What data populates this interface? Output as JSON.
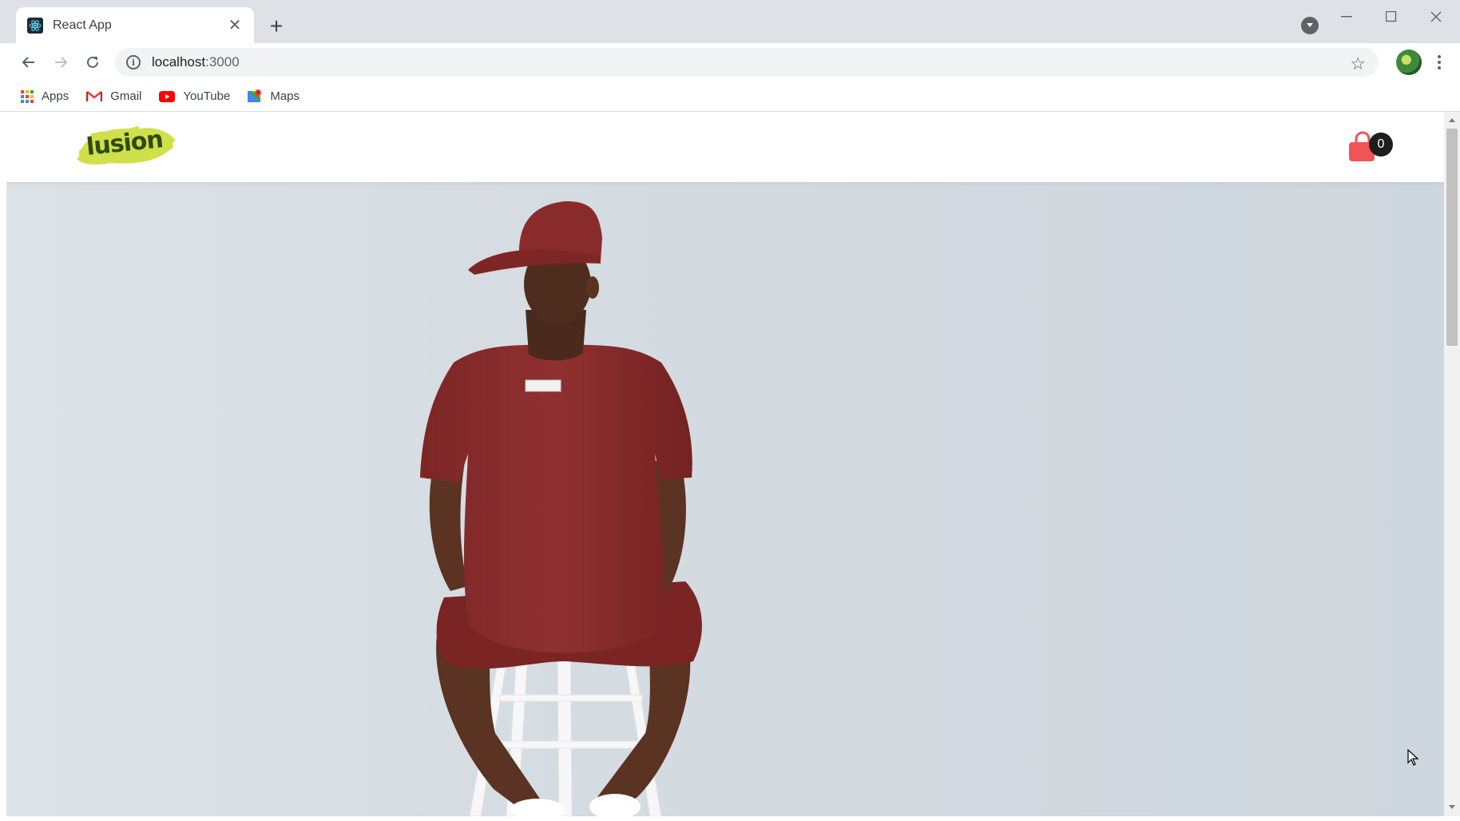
{
  "browser": {
    "tab": {
      "title": "React App"
    },
    "address_bar": {
      "host": "localhost",
      "port": ":3000"
    },
    "bookmarks": [
      {
        "label": "Apps",
        "icon": "apps-grid-icon"
      },
      {
        "label": "Gmail",
        "icon": "gmail-icon"
      },
      {
        "label": "YouTube",
        "icon": "youtube-icon"
      },
      {
        "label": "Maps",
        "icon": "maps-icon"
      }
    ]
  },
  "site": {
    "logo_text": "lusion",
    "cart": {
      "count": "0",
      "icon": "shopping-bag-icon",
      "color": "#f05454"
    }
  },
  "colors": {
    "shirt": "#8c2d2d",
    "background": "#d6dde3",
    "logo_splash": "#cfe04a"
  }
}
